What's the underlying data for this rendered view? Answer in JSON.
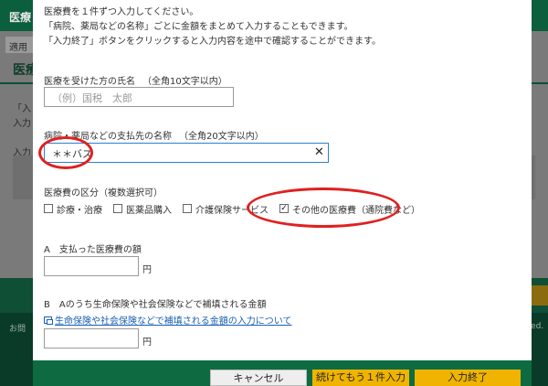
{
  "background": {
    "topbar_text": "医療",
    "subbar_text": "適用",
    "page_title": "医療",
    "line1": "「入",
    "line2": "入力",
    "line3": "入力",
    "footer_left": "お問",
    "footer_right": "rved."
  },
  "modal": {
    "intro": [
      "医療費を１件ずつ入力してください。",
      "「病院、薬局などの名称」ごとに金額をまとめて入力することもできます。",
      "「入力終了」ボタンをクリックすると入力内容を途中で確認することができます。"
    ],
    "name_field": {
      "label": "医療を受けた方の氏名",
      "hint": "（全角10文字以内）",
      "placeholder": "（例）国税　太郎",
      "value": ""
    },
    "payee_field": {
      "label": "病院・薬局などの支払先の名称",
      "hint": "（全角20文字以内）",
      "value": "＊＊バス",
      "clear_icon": "✕"
    },
    "category": {
      "label": "医療費の区分（複数選択可）",
      "options": [
        {
          "label": "診療・治療",
          "checked": false
        },
        {
          "label": "医薬品購入",
          "checked": false
        },
        {
          "label": "介護保険サービス",
          "checked": false
        },
        {
          "label": "その他の医療費（通院費など）",
          "checked": true
        }
      ],
      "check_mark": "✓"
    },
    "amount_a": {
      "label": "A　支払った医療費の額",
      "unit": "円",
      "value": ""
    },
    "amount_b": {
      "label": "B　Aのうち生命保険や社会保険などで補填される金額",
      "link": "生命保険や社会保険などで補填される金額の入力について",
      "unit": "円",
      "value": ""
    },
    "buttons": {
      "cancel": "キャンセル",
      "continue": "続けてもう１件入力",
      "finish": "入力終了"
    }
  },
  "annotation_color": "#e02020",
  "accent_green": "#0e6b41",
  "button_yellow": "#f0b400"
}
